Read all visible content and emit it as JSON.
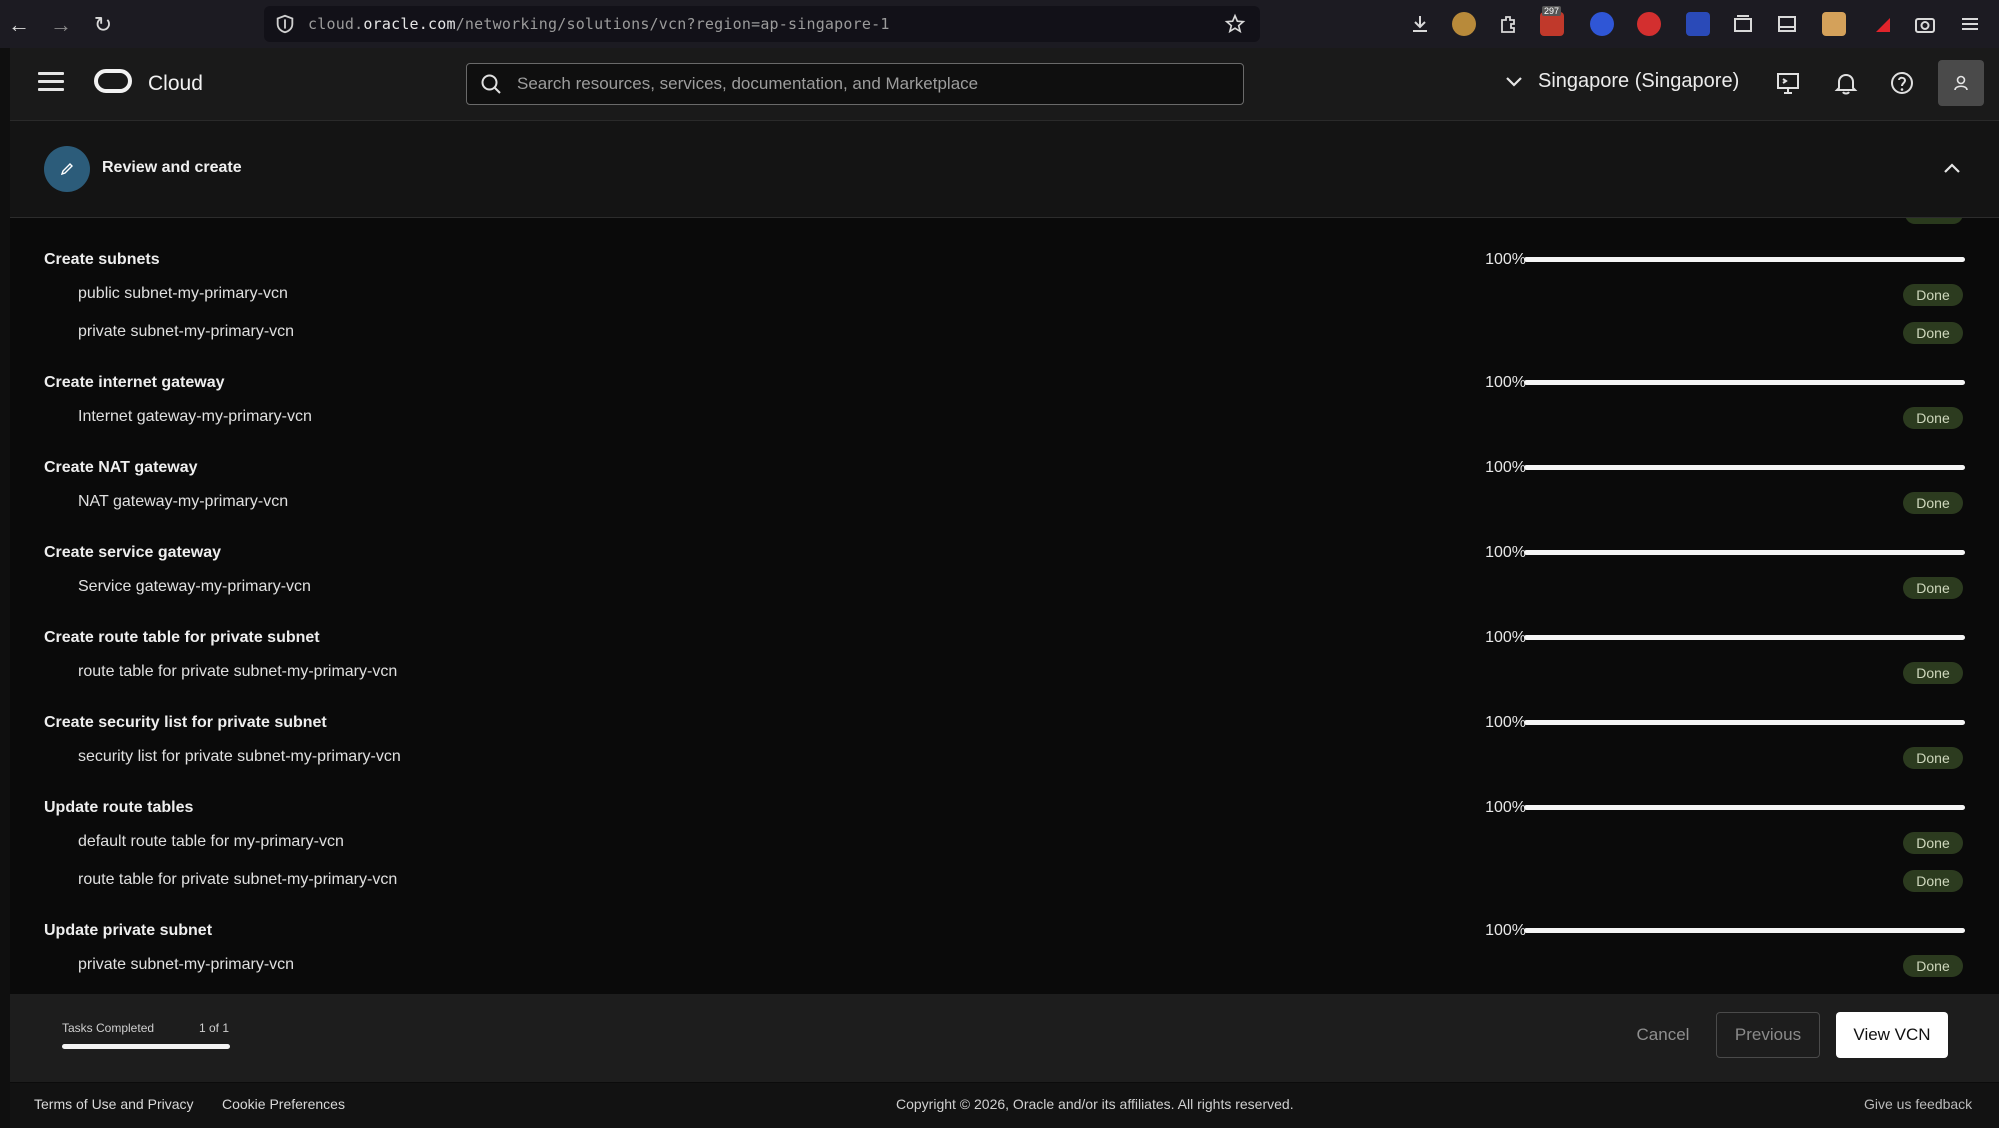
{
  "browser": {
    "url_prefix": "cloud.",
    "url_domain": "oracle.com",
    "url_path": "/networking/solutions/vcn?region=ap-singapore-1",
    "ext_badge": "297"
  },
  "header": {
    "brand": "Cloud",
    "search_placeholder": "Search resources, services, documentation, and Marketplace",
    "region": "Singapore (Singapore)"
  },
  "step": {
    "title": "Review and create"
  },
  "clipped_previous": "Done",
  "groups": [
    {
      "title": "Create subnets",
      "progress": "100%",
      "progress_value": 1.0,
      "items": [
        {
          "label": "public subnet-my-primary-vcn",
          "status": "Done"
        },
        {
          "label": "private subnet-my-primary-vcn",
          "status": "Done"
        }
      ]
    },
    {
      "title": "Create internet gateway",
      "progress": "100%",
      "progress_value": 1.0,
      "items": [
        {
          "label": "Internet gateway-my-primary-vcn",
          "status": "Done"
        }
      ]
    },
    {
      "title": "Create NAT gateway",
      "progress": "100%",
      "progress_value": 1.0,
      "items": [
        {
          "label": "NAT gateway-my-primary-vcn",
          "status": "Done"
        }
      ]
    },
    {
      "title": "Create service gateway",
      "progress": "100%",
      "progress_value": 1.0,
      "items": [
        {
          "label": "Service gateway-my-primary-vcn",
          "status": "Done"
        }
      ]
    },
    {
      "title": "Create route table for private subnet",
      "progress": "100%",
      "progress_value": 1.0,
      "items": [
        {
          "label": "route table for private subnet-my-primary-vcn",
          "status": "Done"
        }
      ]
    },
    {
      "title": "Create security list for private subnet",
      "progress": "100%",
      "progress_value": 1.0,
      "items": [
        {
          "label": "security list for private subnet-my-primary-vcn",
          "status": "Done"
        }
      ]
    },
    {
      "title": "Update route tables",
      "progress": "100%",
      "progress_value": 1.0,
      "items": [
        {
          "label": "default route table for my-primary-vcn",
          "status": "Done"
        },
        {
          "label": "route table for private subnet-my-primary-vcn",
          "status": "Done"
        }
      ]
    },
    {
      "title": "Update private subnet",
      "progress": "100%",
      "progress_value": 1.0,
      "items": [
        {
          "label": "private subnet-my-primary-vcn",
          "status": "Done"
        }
      ]
    }
  ],
  "footer_bar": {
    "tasks_label": "Tasks Completed",
    "tasks_count": "1 of 1",
    "tasks_progress": 1.0,
    "cancel": "Cancel",
    "previous": "Previous",
    "view_vcn": "View VCN"
  },
  "page_footer": {
    "terms": "Terms of Use and Privacy",
    "cookies": "Cookie Preferences",
    "copyright": "Copyright © 2026, Oracle and/or its affiliates. All rights reserved.",
    "feedback": "Give us feedback"
  }
}
